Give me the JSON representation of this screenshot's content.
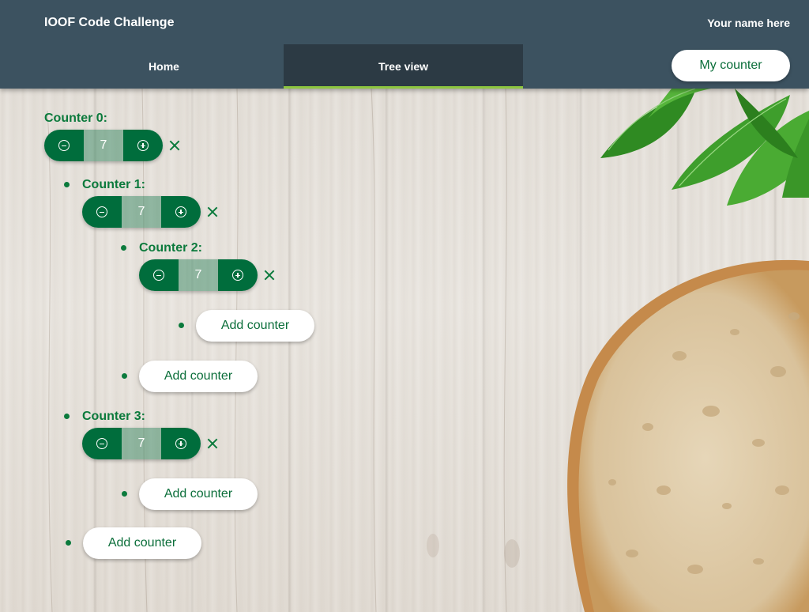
{
  "header": {
    "app_title": "IOOF Code Challenge",
    "user_name": "Your name here",
    "tabs": [
      {
        "label": "Home",
        "active": false
      },
      {
        "label": "Tree view",
        "active": true
      }
    ],
    "my_counter_label": "My counter"
  },
  "tree": {
    "counters": [
      {
        "label": "Counter 0:",
        "value": "7",
        "depth": 0
      },
      {
        "label": "Counter 1:",
        "value": "7",
        "depth": 1
      },
      {
        "label": "Counter 2:",
        "value": "7",
        "depth": 2
      },
      {
        "label": "Counter 3:",
        "value": "7",
        "depth": 1
      }
    ],
    "add_counter_label": "Add counter"
  },
  "icons": {
    "decrement": "minus-circle-icon",
    "increment": "plus-circle-icon",
    "remove": "close-icon"
  },
  "colors": {
    "header_bg": "#3c5260",
    "active_tab_bg": "#2c3a44",
    "active_tab_underline": "#8dc63f",
    "brand_green": "#006d3c",
    "label_green": "#0b7a3c"
  }
}
